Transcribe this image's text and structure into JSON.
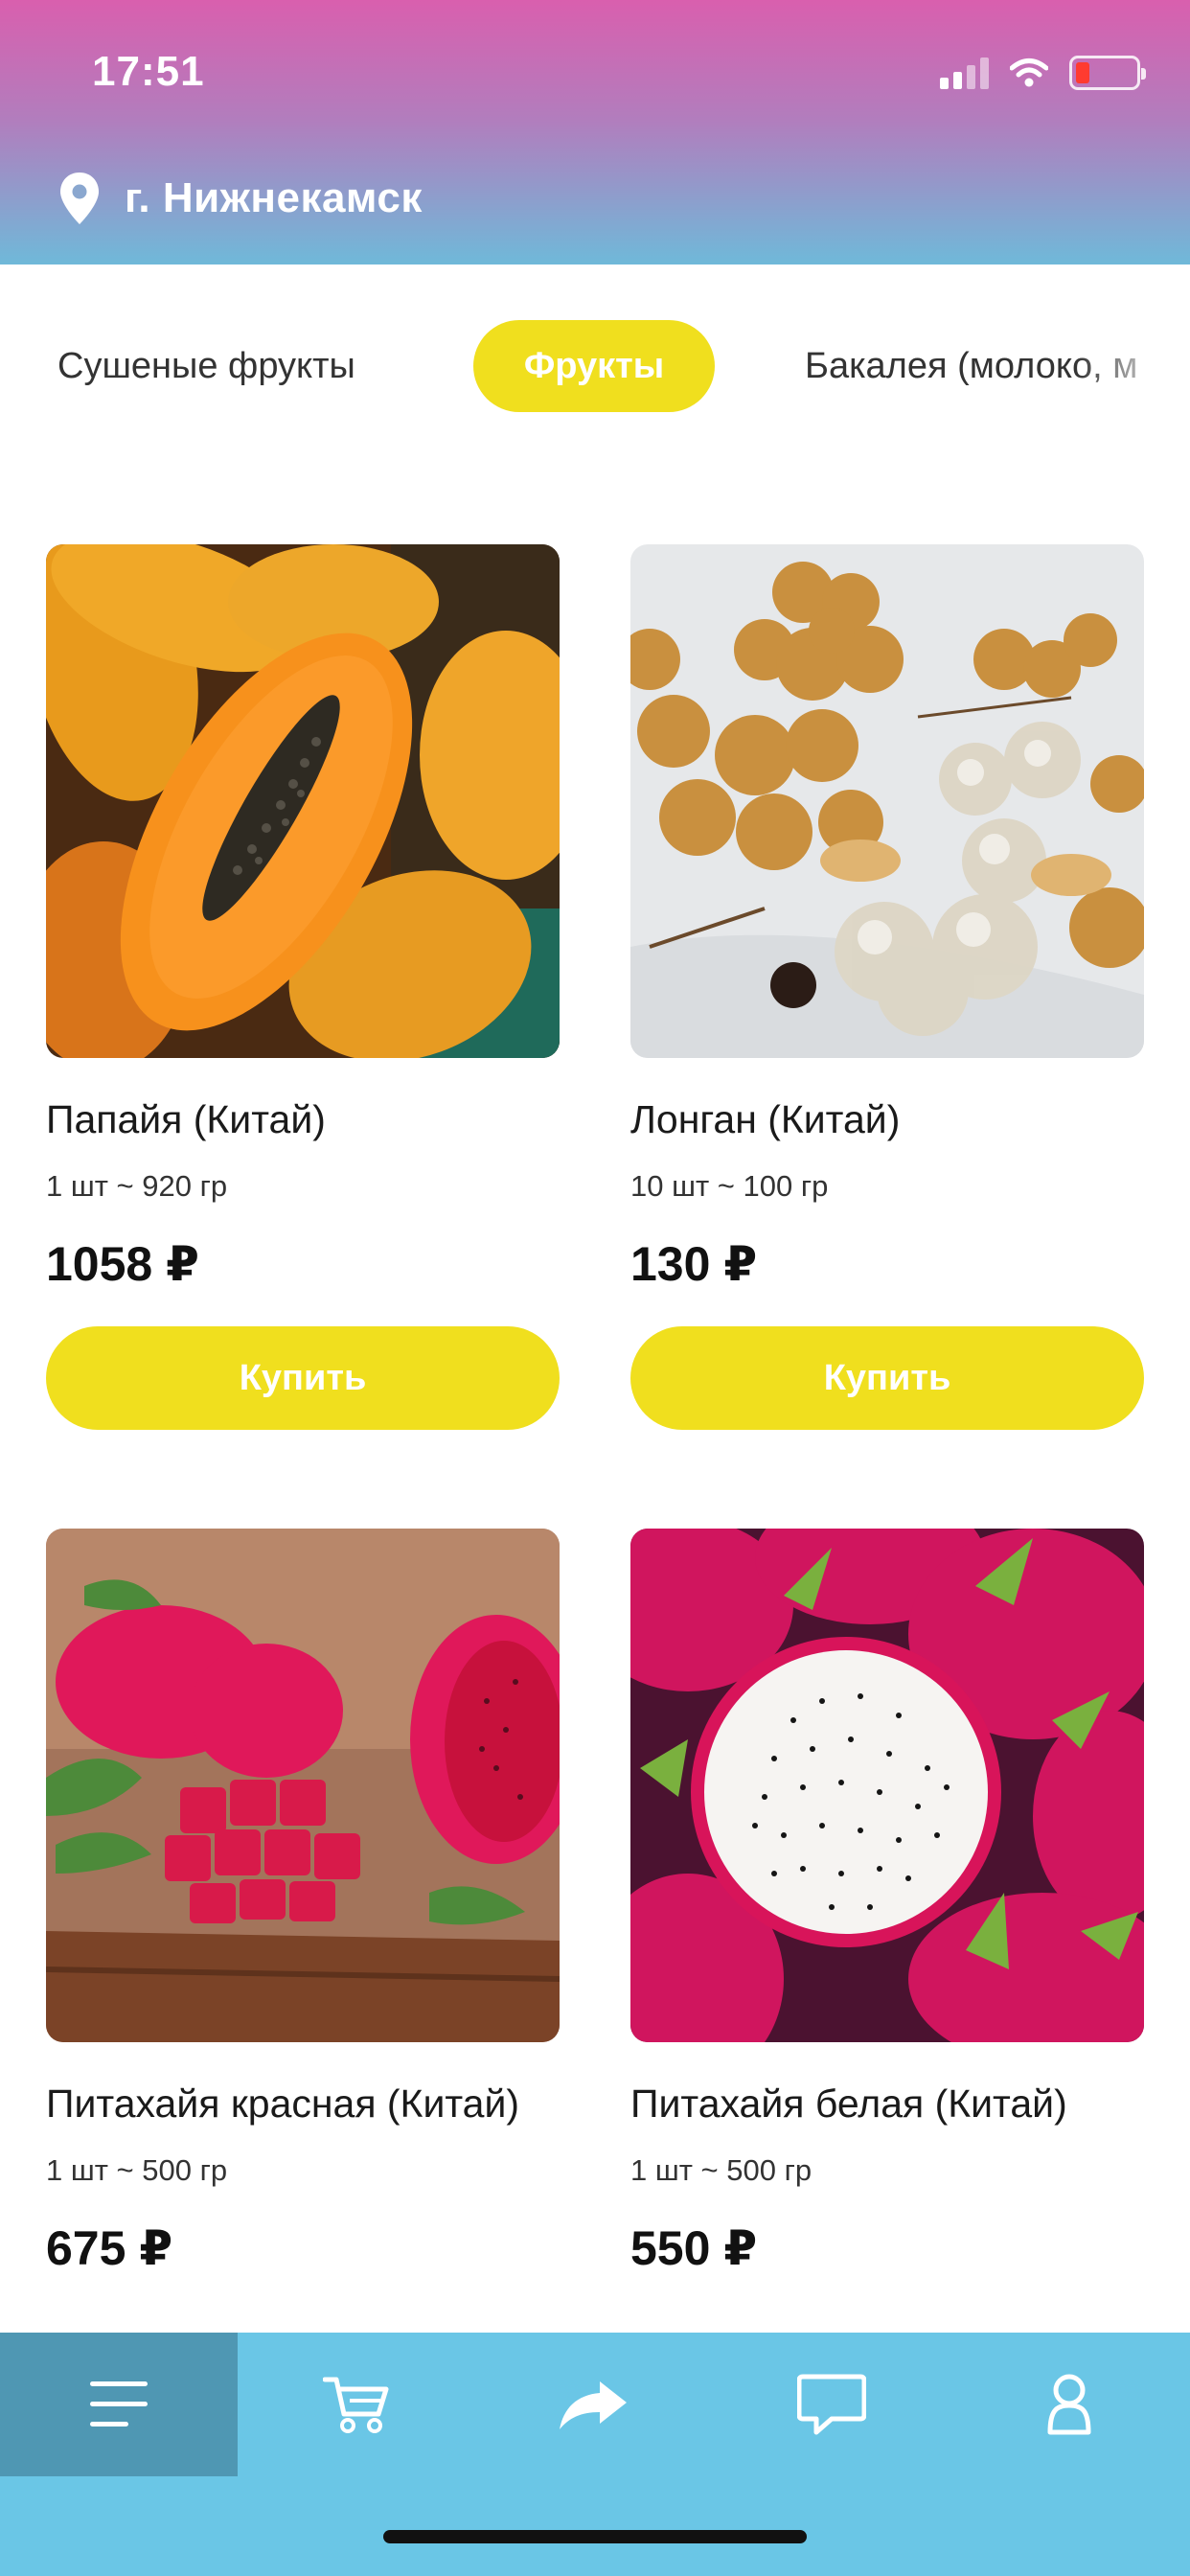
{
  "status_bar": {
    "time": "17:51"
  },
  "location": {
    "city": "г. Нижнекамск",
    "icon": "location-pin-icon"
  },
  "categories": [
    {
      "label": "Сушеные фрукты",
      "active": false
    },
    {
      "label": "Фрукты",
      "active": true
    },
    {
      "label": "Бакалея (молоко, м",
      "active": false
    }
  ],
  "products": [
    {
      "name": "Папайя (Китай)",
      "weight": "1 шт ~ 920 гр",
      "price": "1058 ₽",
      "buy_label": "Купить"
    },
    {
      "name": "Лонган (Китай)",
      "weight": "10 шт ~ 100 гр",
      "price": "130 ₽",
      "buy_label": "Купить"
    },
    {
      "name": "Питахайя красная (Китай)",
      "weight": "1 шт ~ 500 гр",
      "price": "675 ₽"
    },
    {
      "name": "Питахайя белая (Китай)",
      "weight": "1 шт ~ 500 гр",
      "price": "550 ₽"
    }
  ],
  "tabbar": {
    "items": [
      {
        "icon": "menu-icon",
        "active": true
      },
      {
        "icon": "cart-icon",
        "active": false
      },
      {
        "icon": "share-arrow-icon",
        "active": false
      },
      {
        "icon": "chat-icon",
        "active": false
      },
      {
        "icon": "profile-icon",
        "active": false
      }
    ]
  },
  "colors": {
    "accent": "#f0df1e",
    "tabbar": "#6ac6e6",
    "tabbar_active": "#4f97b3",
    "header_top": "#d95fae",
    "header_bottom": "#6fb9d9"
  }
}
